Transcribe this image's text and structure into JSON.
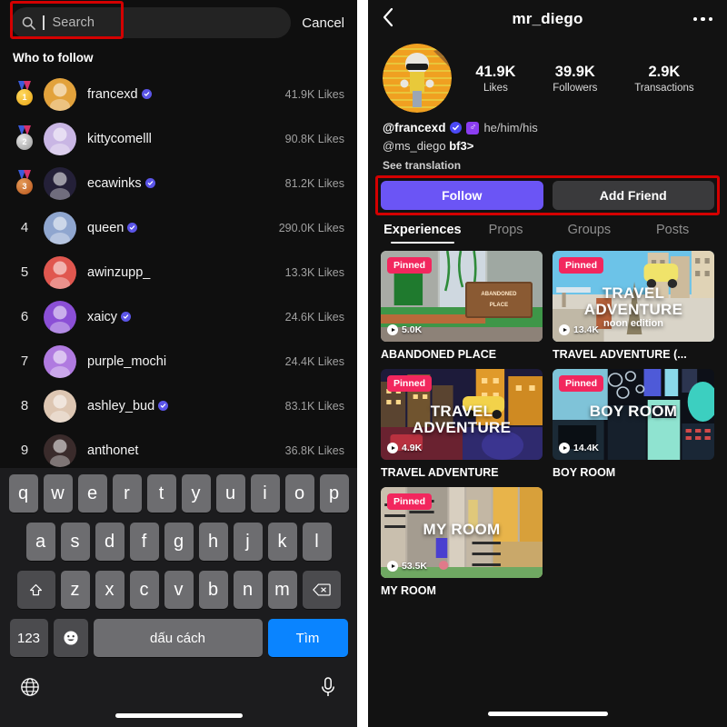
{
  "left_panel": {
    "search": {
      "placeholder": "Search",
      "icon": "search-icon",
      "cancel_label": "Cancel",
      "highlight_color": "#d40000"
    },
    "section_title": "Who to follow",
    "follow_list": [
      {
        "rank": "1",
        "medal": "gold",
        "username": "francexd",
        "verified": true,
        "likes": "41.9K Likes",
        "avatar_bg": "#e2a23c"
      },
      {
        "rank": "2",
        "medal": "silver",
        "username": "kittycomelll",
        "verified": false,
        "likes": "90.8K Likes",
        "avatar_bg": "#c9b6e4"
      },
      {
        "rank": "3",
        "medal": "bronze",
        "username": "ecawinks",
        "verified": true,
        "likes": "81.2K Likes",
        "avatar_bg": "#242038"
      },
      {
        "rank": "4",
        "medal": "",
        "username": "queen",
        "verified": true,
        "likes": "290.0K Likes",
        "avatar_bg": "#8fa6cf"
      },
      {
        "rank": "5",
        "medal": "",
        "username": "awinzupp_",
        "verified": false,
        "likes": "13.3K Likes",
        "avatar_bg": "#e0574f"
      },
      {
        "rank": "6",
        "medal": "",
        "username": "xaicy",
        "verified": true,
        "likes": "24.6K Likes",
        "avatar_bg": "#8b4fd6"
      },
      {
        "rank": "7",
        "medal": "",
        "username": "purple_mochi",
        "verified": false,
        "likes": "24.4K Likes",
        "avatar_bg": "#b07ae0"
      },
      {
        "rank": "8",
        "medal": "",
        "username": "ashley_bud",
        "verified": true,
        "likes": "83.1K Likes",
        "avatar_bg": "#ddc6b2"
      },
      {
        "rank": "9",
        "medal": "",
        "username": "anthonet",
        "verified": false,
        "likes": "36.8K Likes",
        "avatar_bg": "#3a2b2b"
      }
    ],
    "keyboard": {
      "row1": [
        "q",
        "w",
        "e",
        "r",
        "t",
        "y",
        "u",
        "i",
        "o",
        "p"
      ],
      "row2": [
        "a",
        "s",
        "d",
        "f",
        "g",
        "h",
        "j",
        "k",
        "l"
      ],
      "row3": [
        "z",
        "x",
        "c",
        "v",
        "b",
        "n",
        "m"
      ],
      "shift_icon": "shift-arrow-icon",
      "backspace_icon": "backspace-icon",
      "numbers_label": "123",
      "emoji_icon": "emoji-smiley-icon",
      "space_label": "dấu cách",
      "go_label": "Tìm",
      "globe_icon": "globe-icon",
      "mic_icon": "microphone-icon",
      "go_color": "#0a84ff"
    }
  },
  "right_panel": {
    "topbar": {
      "back_icon": "back-chevron-icon",
      "title": "mr_diego",
      "more_icon": "more-options-icon"
    },
    "profile": {
      "avatar_name": "profile-avatar",
      "stats": [
        {
          "value": "41.9K",
          "label": "Likes"
        },
        {
          "value": "39.9K",
          "label": "Followers"
        },
        {
          "value": "2.9K",
          "label": "Transactions"
        }
      ],
      "handle": "@francexd",
      "verified_icon": "verified-badge-icon",
      "pronoun_badge_icon": "gender-male-icon",
      "pronouns": "he/him/his",
      "bio_handle": "@ms_diego",
      "bio_text": "bf3>",
      "see_translation": "See translation"
    },
    "actions": {
      "follow_label": "Follow",
      "add_friend_label": "Add Friend",
      "follow_color": "#6b55f5",
      "highlight_color": "#d40000"
    },
    "tabs": [
      {
        "label": "Experiences",
        "active": true
      },
      {
        "label": "Props",
        "active": false
      },
      {
        "label": "Groups",
        "active": false
      },
      {
        "label": "Posts",
        "active": false
      }
    ],
    "experiences": [
      {
        "badge": "Pinned",
        "plays": "5.0K",
        "title": "ABANDONED PLACE",
        "overlay_big": "",
        "overlay_small": "",
        "thumb_style": "abandoned"
      },
      {
        "badge": "Pinned",
        "plays": "13.4K",
        "title": "TRAVEL ADVENTURE (...",
        "overlay_big": "TRAVEL ADVENTURE",
        "overlay_small": "noon edition",
        "thumb_style": "travel-noon"
      },
      {
        "badge": "Pinned",
        "plays": "4.9K",
        "title": "TRAVEL ADVENTURE",
        "overlay_big": "TRAVEL ADVENTURE",
        "overlay_small": "",
        "thumb_style": "travel-night"
      },
      {
        "badge": "Pinned",
        "plays": "14.4K",
        "title": "BOY ROOM",
        "overlay_big": "BOY ROOM",
        "overlay_small": "",
        "thumb_style": "boyroom"
      },
      {
        "badge": "Pinned",
        "plays": "53.5K",
        "title": "MY ROOM",
        "overlay_big": "MY ROOM",
        "overlay_small": "",
        "thumb_style": "myroom"
      }
    ]
  }
}
